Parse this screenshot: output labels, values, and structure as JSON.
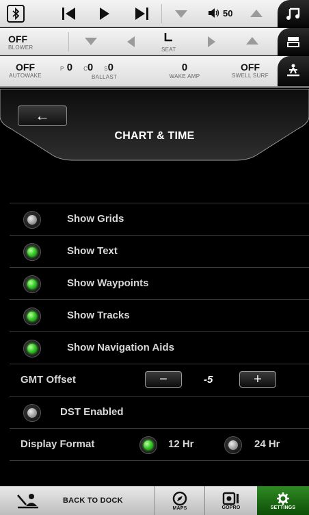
{
  "topbar": {
    "bluetooth_icon": "bluetooth-icon",
    "volume_value": "50",
    "music_icon": "music-note-icon"
  },
  "row2": {
    "blower_value": "OFF",
    "blower_label": "BLOWER",
    "seat_label": "SEAT",
    "side_icon": "panel-icon"
  },
  "row3": {
    "autowake_value": "OFF",
    "autowake_label": "AUTOWAKE",
    "ballast_label": "BALLAST",
    "ballast_p_prefix": "P",
    "ballast_p": "0",
    "ballast_c_prefix": "C",
    "ballast_c": "0",
    "ballast_s_prefix": "S",
    "ballast_s": "0",
    "wake_amp_value": "0",
    "wake_amp_label": "WAKE AMP",
    "swell_value": "OFF",
    "swell_label": "SWELL SURF",
    "side_icon": "wakeboarder-icon"
  },
  "header": {
    "back_icon": "back-arrow-icon",
    "back_glyph": "←",
    "title": "CHART & TIME"
  },
  "options": [
    {
      "label": "Show Grids",
      "checked": false
    },
    {
      "label": "Show Text",
      "checked": true
    },
    {
      "label": "Show Waypoints",
      "checked": true
    },
    {
      "label": "Show Tracks",
      "checked": true
    },
    {
      "label": "Show Navigation Aids",
      "checked": true
    }
  ],
  "gmt": {
    "label": "GMT Offset",
    "minus": "−",
    "value": "-5",
    "plus": "+"
  },
  "dst": {
    "label": "DST Enabled",
    "checked": false
  },
  "display_format": {
    "label": "Display Format",
    "options": [
      {
        "label": "12 Hr",
        "checked": true
      },
      {
        "label": "24 Hr",
        "checked": false
      }
    ]
  },
  "nav": {
    "dock_label": "BACK TO DOCK",
    "maps_label": "MAPS",
    "gopro_label": "GOPRO",
    "settings_label": "SETTINGS",
    "active": "SETTINGS"
  },
  "colors": {
    "accent_green": "#2bc21f",
    "nav_active": "#1f6a15"
  }
}
